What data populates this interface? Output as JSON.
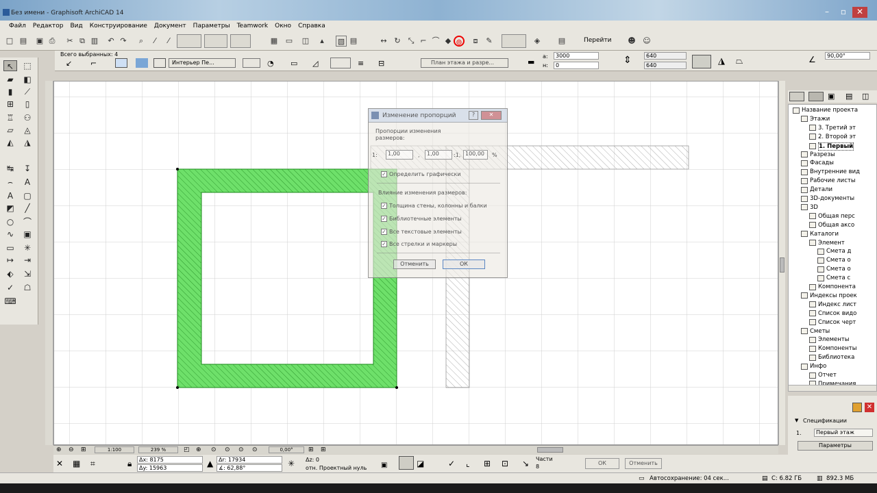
{
  "window": {
    "title": "Без имени - Graphisoft ArchiCAD 14"
  },
  "menu": [
    "Файл",
    "Редактор",
    "Вид",
    "Конструирование",
    "Документ",
    "Параметры",
    "Teamwork",
    "Окно",
    "Справка"
  ],
  "toolbar": {
    "goto_label": "Перейти"
  },
  "info": {
    "selected": "Всего выбранных: 4",
    "interior_label": "Интерьер Пе...",
    "floor_label": "План этажа и разре...",
    "dim1": "3000",
    "dim2": "0",
    "h1": "640",
    "h2": "640",
    "angle": "90,00°"
  },
  "dialog": {
    "title": "Изменение пропорций",
    "section1": "Пропорции изменения размеров:",
    "ratio_prefix": "1:",
    "ratio_a": "1,00",
    "ratio_b": "1,00",
    "ratio_c": "100,00",
    "ratio_sep1": ",",
    "ratio_sep2": ":1,",
    "percent": "%",
    "graphic_label": "Определить графически",
    "section2": "Влияние изменения размеров:",
    "opt1": "Толщина стены, колонны и балки",
    "opt2": "Библиотечные элементы",
    "opt3": "Все текстовые элементы",
    "opt4": "Все стрелки и маркеры",
    "cancel": "Отменить",
    "ok": "ОК"
  },
  "navigator": {
    "items": [
      {
        "label": "Название проекта",
        "indent": 0,
        "icon": "project-icon"
      },
      {
        "label": "Этажи",
        "indent": 1,
        "icon": "stories-icon"
      },
      {
        "label": "3. Третий эт",
        "indent": 2,
        "icon": "story-icon"
      },
      {
        "label": "2. Второй эт",
        "indent": 2,
        "icon": "story-icon"
      },
      {
        "label": "1. Первый",
        "indent": 2,
        "icon": "story-icon",
        "bold": true
      },
      {
        "label": "Разрезы",
        "indent": 1,
        "icon": "section-icon"
      },
      {
        "label": "Фасады",
        "indent": 1,
        "icon": "elevation-icon"
      },
      {
        "label": "Внутренние вид",
        "indent": 1,
        "icon": "interior-icon"
      },
      {
        "label": "Рабочие листы",
        "indent": 1,
        "icon": "worksheet-icon"
      },
      {
        "label": "Детали",
        "indent": 1,
        "icon": "detail-icon"
      },
      {
        "label": "3D-документы",
        "indent": 1,
        "icon": "3d-doc-icon"
      },
      {
        "label": "3D",
        "indent": 1,
        "icon": "3d-icon"
      },
      {
        "label": "Общая перс",
        "indent": 2,
        "icon": "perspective-icon"
      },
      {
        "label": "Общая аксо",
        "indent": 2,
        "icon": "axonometry-icon"
      },
      {
        "label": "Каталоги",
        "indent": 1,
        "icon": "catalog-icon"
      },
      {
        "label": "Элемент",
        "indent": 2,
        "icon": "element-icon"
      },
      {
        "label": "Смета д",
        "indent": 3,
        "icon": "list-icon"
      },
      {
        "label": "Смета о",
        "indent": 3,
        "icon": "list-icon"
      },
      {
        "label": "Смета о",
        "indent": 3,
        "icon": "list-icon"
      },
      {
        "label": "Смета с",
        "indent": 3,
        "icon": "list-icon"
      },
      {
        "label": "Компонента",
        "indent": 2,
        "icon": "component-icon"
      },
      {
        "label": "Индексы проек",
        "indent": 1,
        "icon": "index-icon"
      },
      {
        "label": "Индекс лист",
        "indent": 2,
        "icon": "list-icon"
      },
      {
        "label": "Список видо",
        "indent": 2,
        "icon": "list-icon"
      },
      {
        "label": "Список черт",
        "indent": 2,
        "icon": "list-icon"
      },
      {
        "label": "Сметы",
        "indent": 1,
        "icon": "schedule-icon"
      },
      {
        "label": "Элементы",
        "indent": 2,
        "icon": "list-icon"
      },
      {
        "label": "Компоненты",
        "indent": 2,
        "icon": "list-icon"
      },
      {
        "label": "Библиотека",
        "indent": 2,
        "icon": "list-icon"
      },
      {
        "label": "Инфо",
        "indent": 1,
        "icon": "info-icon"
      },
      {
        "label": "Отчет",
        "indent": 2,
        "icon": "report-icon"
      },
      {
        "label": "Примечания",
        "indent": 2,
        "icon": "notes-icon"
      }
    ],
    "spec_label": "Спецификации",
    "story_num": "1.",
    "story_name": "Первый этаж",
    "params_btn": "Параметры"
  },
  "bottom": {
    "scale": "1:100",
    "zoom": "239 %",
    "angle": "0,00°"
  },
  "coords": {
    "dx": "Δx: 8175",
    "dy": "Δy: 15963",
    "dr": "Δr: 17934",
    "da": "∡: 62,88°",
    "dz": "Δz: 0",
    "ref": "отн. Проектный нуль",
    "parts_label": "Части",
    "parts_value": "8",
    "ok": "ОК",
    "cancel": "Отменить"
  },
  "status": {
    "autosave": "Автосохранение: 04 сек...",
    "disk": "C: 6.82 ГБ",
    "mem": "892.3 МБ"
  },
  "colors": {
    "wall_fill": "#6ee06a",
    "wall_line": "#1a8a1a",
    "grid": "#cfcfcf"
  }
}
